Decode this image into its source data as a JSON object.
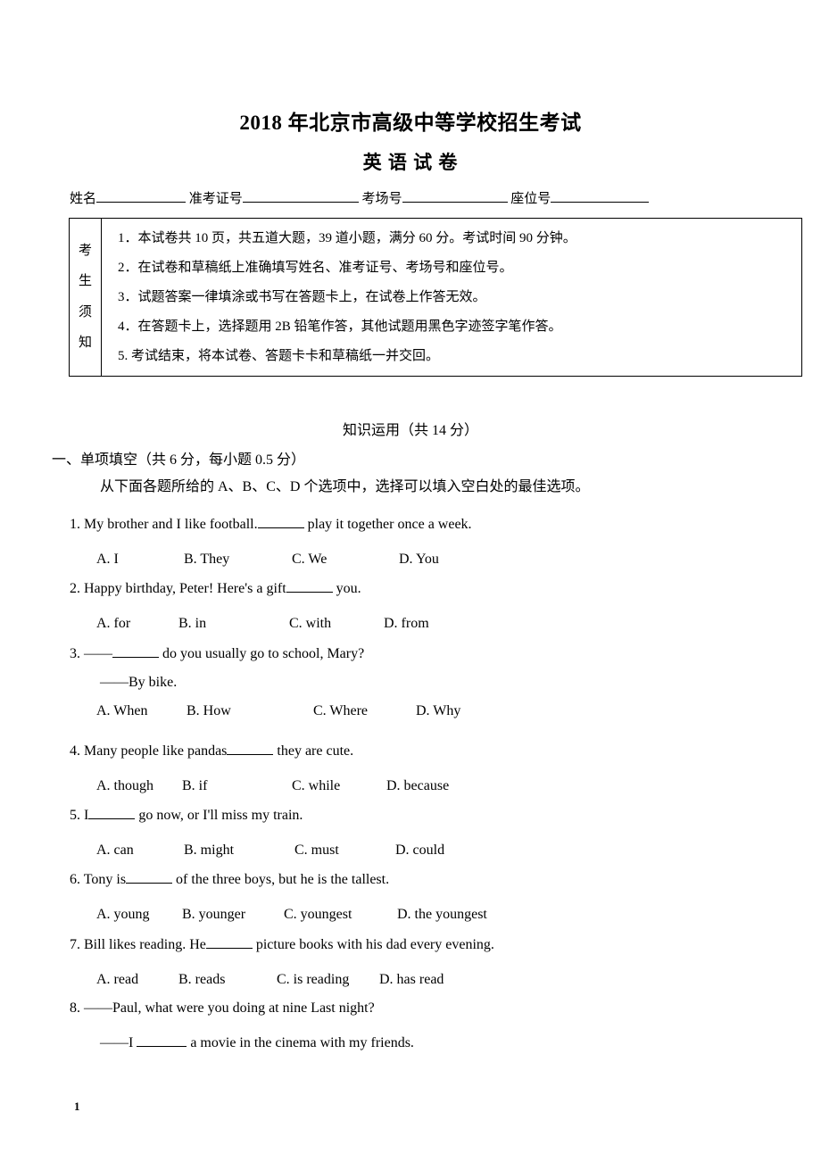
{
  "document": {
    "title": "2018 年北京市高级中等学校招生考试",
    "subtitle": "英    语    试    卷",
    "page_number": "1"
  },
  "identity_line": {
    "name_label": "姓名",
    "admission_label": "准考证号",
    "room_label": "考场号",
    "seat_label": "座位号"
  },
  "notice": {
    "label_chars": [
      "考",
      "生",
      "须",
      "知"
    ],
    "items": [
      "1．本试卷共 10 页，共五道大题，39 道小题，满分 60 分。考试时间 90 分钟。",
      "2．在试卷和草稿纸上准确填写姓名、准考证号、考场号和座位号。",
      "3．试题答案一律填涂或书写在答题卡上，在试卷上作答无效。",
      "4．在答题卡上，选择题用 2B 铅笔作答，其他试题用黑色字迹签字笔作答。",
      "5. 考试结束，将本试卷、答题卡卡和草稿纸一并交回。"
    ]
  },
  "section": {
    "title": "知识运用（共 14 分）",
    "part_title": "一、单项填空（共 6 分，每小题 0.5 分）",
    "part_instruction": "从下面各题所给的 A、B、C、D 个选项中，选择可以填入空白处的最佳选项。"
  },
  "questions": [
    {
      "stem_before": "1. My brother and I like football.",
      "stem_after": " play it together once a week.",
      "options": [
        "A. I",
        "B. They",
        "C. We",
        "D. You"
      ]
    },
    {
      "stem_before": "2. Happy birthday, Peter! Here's a gift",
      "stem_after": " you.",
      "options": [
        "A. for",
        "B. in",
        "C. with",
        "D. from"
      ]
    },
    {
      "stem_before": "3. ——",
      "stem_after": " do you usually go to school, Mary?",
      "continuation": "——By bike.",
      "options": [
        "A. When",
        "B. How",
        "C. Where",
        "D. Why"
      ]
    },
    {
      "stem_before": "4. Many people like pandas",
      "stem_after": " they are cute.",
      "options": [
        "A. though",
        "B. if",
        "C. while",
        "D. because"
      ]
    },
    {
      "stem_before": "5. I",
      "stem_after": " go now, or I'll miss my train.",
      "options": [
        "A. can",
        "B. might",
        "C. must",
        "D. could"
      ]
    },
    {
      "stem_before": "6. Tony is",
      "stem_after": " of the three boys, but he is the tallest.",
      "options": [
        "A. young",
        "B. younger",
        "C. youngest",
        "D. the youngest"
      ]
    },
    {
      "stem_before": "7. Bill likes reading. He",
      "stem_after": " picture books with his dad every evening.",
      "options": [
        "A. read",
        "B. reads",
        "C. is reading",
        "D. has read"
      ]
    },
    {
      "stem_before": "8. ——Paul, what were you doing at nine Last night?",
      "stem_after": "",
      "continuation_before": "——I  ",
      "continuation_after": " a movie in the cinema with my friends."
    }
  ]
}
